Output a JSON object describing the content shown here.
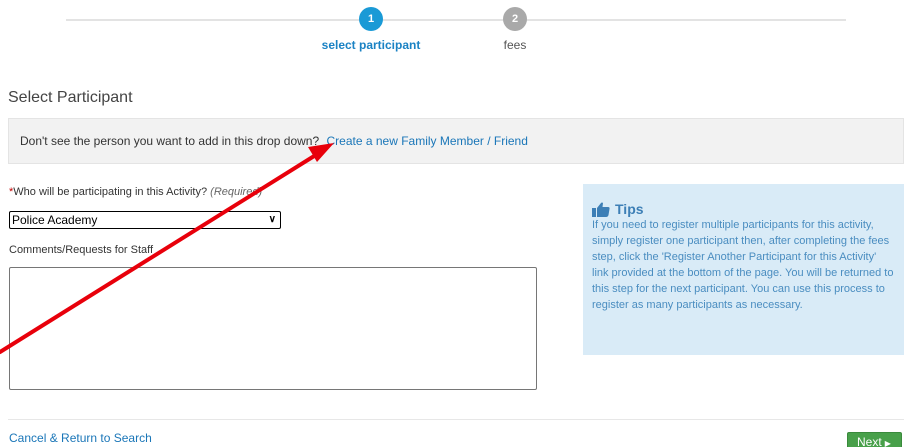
{
  "stepper": {
    "steps": [
      {
        "number": "1",
        "label": "select participant",
        "state": "active"
      },
      {
        "number": "2",
        "label": "fees",
        "state": "inactive"
      }
    ]
  },
  "section_title": "Select Participant",
  "info_bar": {
    "text": "Don't see the person you want to add in this drop down?",
    "link": "Create a new Family Member / Friend"
  },
  "participant": {
    "required_mark": "*",
    "question": "Who will be participating in this Activity?",
    "required_text": "(Required)",
    "selected": "Police Academy"
  },
  "comments": {
    "label": "Comments/Requests for Staff",
    "value": ""
  },
  "tips": {
    "title": "Tips",
    "body": "If you need to register multiple participants for this activity, simply register one participant then, after completing the fees step, click the 'Register Another Participant for this Activity' link provided at the bottom of the page. You will be returned to this step for the next participant. You can use this process to register as many participants as necessary."
  },
  "footer": {
    "cancel_link": "Cancel & Return to Search",
    "next_label": "Next"
  },
  "colors": {
    "active_step": "#1a9ad6",
    "inactive_step": "#a9a9a9",
    "link": "#1a76b8",
    "tips_bg": "#d9ebf7",
    "next_button": "#48a04a",
    "annotation_arrow": "#e8000b"
  },
  "icons": {
    "tips": "thumbs-up-icon",
    "select": "chevron-down-icon",
    "next": "caret-right-icon"
  }
}
